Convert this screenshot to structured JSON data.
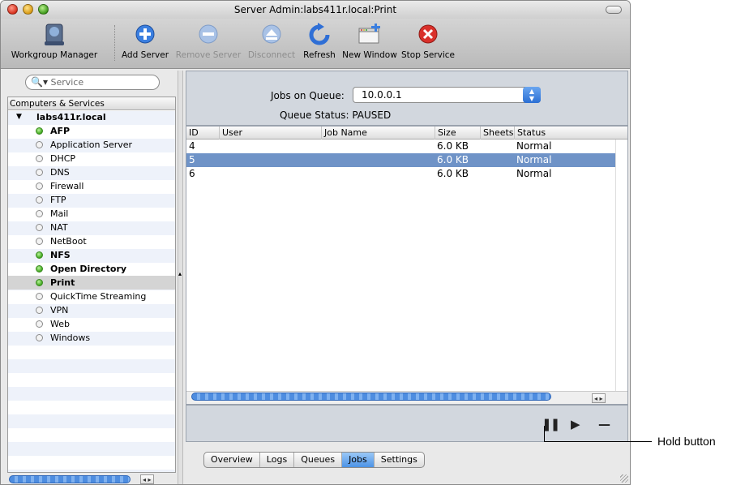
{
  "window": {
    "title": "Server Admin:labs411r.local:Print"
  },
  "toolbar": {
    "items": [
      {
        "label": "Workgroup Manager",
        "icon": "workgroup-manager-icon",
        "enabled": true
      },
      {
        "label": "Add Server",
        "icon": "add-server-icon",
        "enabled": true
      },
      {
        "label": "Remove Server",
        "icon": "remove-server-icon",
        "enabled": false
      },
      {
        "label": "Disconnect",
        "icon": "disconnect-icon",
        "enabled": false
      },
      {
        "label": "Refresh",
        "icon": "refresh-icon",
        "enabled": true
      },
      {
        "label": "New Window",
        "icon": "new-window-icon",
        "enabled": true
      },
      {
        "label": "Stop Service",
        "icon": "stop-service-icon",
        "enabled": true
      }
    ]
  },
  "sidebar": {
    "search_placeholder": "Service",
    "header": "Computers & Services",
    "host": "labs411r.local",
    "services": [
      {
        "label": "AFP",
        "running": true,
        "bold": true
      },
      {
        "label": "Application Server",
        "running": false,
        "bold": false
      },
      {
        "label": "DHCP",
        "running": false,
        "bold": false
      },
      {
        "label": "DNS",
        "running": false,
        "bold": false
      },
      {
        "label": "Firewall",
        "running": false,
        "bold": false
      },
      {
        "label": "FTP",
        "running": false,
        "bold": false
      },
      {
        "label": "Mail",
        "running": false,
        "bold": false
      },
      {
        "label": "NAT",
        "running": false,
        "bold": false
      },
      {
        "label": "NetBoot",
        "running": false,
        "bold": false
      },
      {
        "label": "NFS",
        "running": true,
        "bold": true
      },
      {
        "label": "Open Directory",
        "running": true,
        "bold": true
      },
      {
        "label": "Print",
        "running": true,
        "bold": true,
        "selected": true
      },
      {
        "label": "QuickTime Streaming",
        "running": false,
        "bold": false
      },
      {
        "label": "VPN",
        "running": false,
        "bold": false
      },
      {
        "label": "Web",
        "running": false,
        "bold": false
      },
      {
        "label": "Windows",
        "running": false,
        "bold": false
      }
    ]
  },
  "queue": {
    "jobs_on_queue_label": "Jobs on Queue:",
    "selected_queue": "10.0.0.1",
    "status_text": "Queue Status: PAUSED"
  },
  "jobs_table": {
    "columns": [
      "ID",
      "User",
      "Job Name",
      "Size",
      "Sheets",
      "Status"
    ],
    "rows": [
      {
        "id": "4",
        "user": "",
        "job_name": "",
        "size": "6.0 KB",
        "sheets": "",
        "status": "Normal"
      },
      {
        "id": "5",
        "user": "",
        "job_name": "",
        "size": "6.0 KB",
        "sheets": "",
        "status": "Normal",
        "selected": true
      },
      {
        "id": "6",
        "user": "",
        "job_name": "",
        "size": "6.0 KB",
        "sheets": "",
        "status": "Normal"
      }
    ]
  },
  "controls": {
    "hold_icon": "pause-icon",
    "resume_icon": "play-icon",
    "remove_icon": "minus-icon"
  },
  "tabs": [
    "Overview",
    "Logs",
    "Queues",
    "Jobs",
    "Settings"
  ],
  "active_tab": "Jobs",
  "callout": {
    "text": "Hold button"
  },
  "colors": {
    "selection": "#6f93c7",
    "active_tab": "#4c93e6",
    "running_dot": "#3fa61e"
  }
}
